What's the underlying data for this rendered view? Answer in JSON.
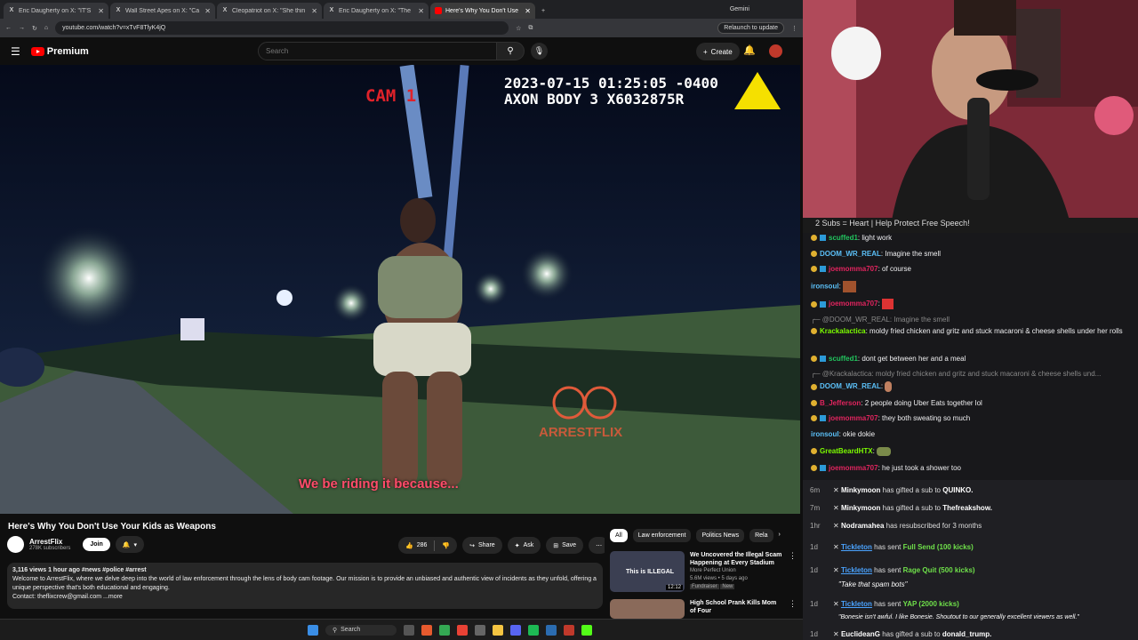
{
  "browser": {
    "tabs": [
      "Eric Daugherty on X: \"IT'S",
      "Wall Street Apes on X: \"Ca",
      "Cleopatriot on X: \"She thin",
      "Eric Daugherty on X: \"The",
      "Here's Why You Don't Use"
    ],
    "gemini": "Gemini",
    "url": "youtube.com/watch?v=xTvF8TlyK4jQ",
    "relaunch": "Relaunch to update"
  },
  "youtube": {
    "brand": "Premium",
    "search_placeholder": "Search",
    "create": "Create"
  },
  "video": {
    "cam_label": "CAM 1",
    "timestamp": "2023-07-15 01:25:05 -0400\nAXON BODY 3 X6032875R",
    "caption": "We be riding it because...",
    "watermark": "ARRESTFLIX"
  },
  "meta": {
    "title": "Here's Why You Don't Use Your Kids as Weapons",
    "channel": "ArrestFlix",
    "subscribers": "278K subscribers",
    "join": "Join",
    "likes": "286",
    "share": "Share",
    "ask": "Ask",
    "save": "Save",
    "desc_line1": "3,116 views  1 hour ago  #news #police #arrest",
    "desc_line2": "Welcome to ArrestFlix, where we delve deep into the world of law enforcement through the lens of body cam footage. Our mission is to provide an unbiased and authentic view of incidents as they unfold, offering a",
    "desc_line3": "unique perspective that's both educational and engaging.",
    "desc_line4": "Contact: theflixcrew@gmail.com   ...more"
  },
  "recs": {
    "chips": [
      "All",
      "Law enforcement",
      "Politics News",
      "Rela"
    ],
    "items": [
      {
        "title": "We Uncovered the Illegal Scam Happening at Every Stadium",
        "channel": "More Perfect Union",
        "meta": "5.6M views • 5 days ago",
        "badge": "Fundraiser",
        "new": "New",
        "duration": "12:12",
        "thumb_text": "This is ILLEGAL"
      },
      {
        "title": "High School Prank Kills Mom of Four",
        "channel": "",
        "meta": "",
        "badge": "",
        "new": "",
        "duration": "",
        "thumb_text": ""
      }
    ]
  },
  "taskbar": {
    "search": "Search"
  },
  "stream": {
    "banner": "2 Subs = Heart | Help Protect Free Speech!",
    "chat": [
      {
        "user": "scuffed1",
        "text": "light work",
        "color": "#22c55e"
      },
      {
        "user": "DOOM_WR_REAL",
        "text": "Imagine the smell",
        "color": "#5bc0f8"
      },
      {
        "user": "joemomma707",
        "text": "of course",
        "color": "#e0245e"
      },
      {
        "user": "ironsoul",
        "text": "",
        "color": "#5bc0f8"
      },
      {
        "user": "joemomma707",
        "text": "",
        "color": "#e0245e"
      },
      {
        "user": "",
        "text": "@DOOM_WR_REAL: Imagine the smell",
        "color": ""
      },
      {
        "user": "Krackalactica",
        "text": "moldy fried chicken and gritz and stuck macaroni & cheese shells under her rolls",
        "color": "#7cfc00"
      },
      {
        "user": "scuffed1",
        "text": "dont get between her and a meal",
        "color": "#22c55e"
      },
      {
        "user": "",
        "text": "@Krackalactica: moldy fried chicken and gritz and stuck macaroni & cheese shells und...",
        "color": ""
      },
      {
        "user": "DOOM_WR_REAL",
        "text": "",
        "color": "#5bc0f8"
      },
      {
        "user": "B_Jefferson",
        "text": "2 people doing Uber Eats together lol",
        "color": "#e0245e"
      },
      {
        "user": "joemomma707",
        "text": "they both sweating so much",
        "color": "#e0245e"
      },
      {
        "user": "ironsoul",
        "text": "okie dokie",
        "color": "#5bc0f8"
      },
      {
        "user": "GreatBeardHTX",
        "text": "",
        "color": "#7cfc00"
      },
      {
        "user": "joemomma707",
        "text": "he just took a shower too",
        "color": "#e0245e"
      }
    ],
    "events": [
      {
        "time": "6m",
        "user": "Minkymoon",
        "text": "has gifted a sub to",
        "target": "QUINKO."
      },
      {
        "time": "7m",
        "user": "Minkymoon",
        "text": "has gifted a sub to",
        "target": "Thefreakshow."
      },
      {
        "time": "1hr",
        "user": "Nodramahea",
        "text": "has resubscribed for 3 months",
        "target": ""
      },
      {
        "time": "1d",
        "user": "Tickleton",
        "text": "has sent",
        "target": "Full Send (100 kicks)",
        "quote": ""
      },
      {
        "time": "1d",
        "user": "Tickleton",
        "text": "has sent",
        "target": "Rage Quit (500 kicks)",
        "quote": "\"Take that spam bots\""
      },
      {
        "time": "1d",
        "user": "Tickleton",
        "text": "has sent",
        "target": "YAP (2000 kicks)",
        "quote": "\"Bonesie isn't awful. I like Bonesie. Shoutout to our generally excellent viewers as well.\""
      },
      {
        "time": "1d",
        "user": "EuclideanG",
        "text": "has gifted a sub to",
        "target": "donald_trump."
      }
    ]
  }
}
